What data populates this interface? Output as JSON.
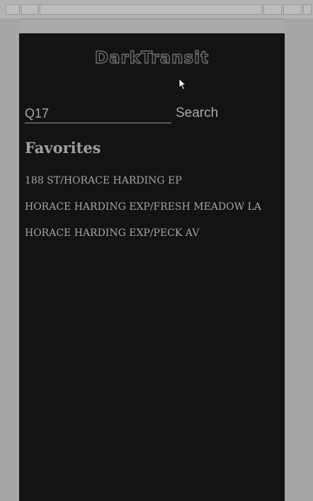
{
  "app": {
    "logo_text": "DarkTransit"
  },
  "search": {
    "value": "Q17",
    "button_label": "Search"
  },
  "favorites": {
    "title": "Favorites",
    "items": [
      "188 ST/HORACE HARDING EP",
      "HORACE HARDING EXP/FRESH MEADOW LA",
      "HORACE HARDING EXP/PECK AV"
    ]
  },
  "colors": {
    "app_background": "#131313",
    "outer_background": "#a9a9a9",
    "text": "#a3a3a3"
  },
  "icons": {
    "pointer": "mouse-pointer-icon"
  }
}
